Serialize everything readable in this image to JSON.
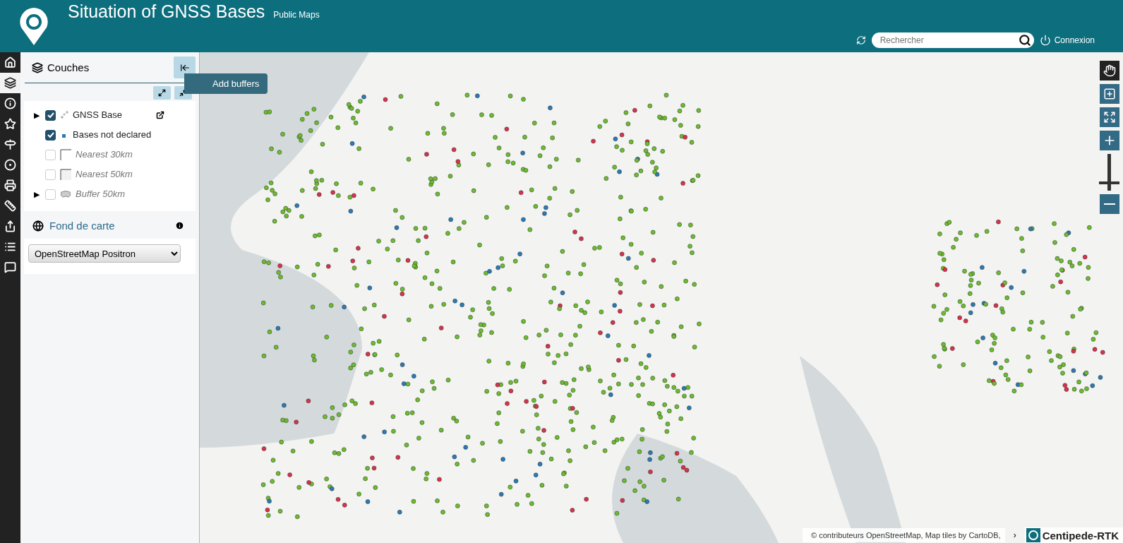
{
  "header": {
    "title": "Situation of GNSS Bases",
    "subtitle": "Public Maps",
    "search": {
      "placeholder": "Rechercher"
    },
    "login": "Connexion"
  },
  "sidebar": {
    "items": [
      {
        "selected": false
      },
      {
        "selected": true
      },
      {
        "selected": false
      },
      {
        "selected": false
      },
      {
        "selected": false
      },
      {
        "selected": false
      },
      {
        "selected": false
      },
      {
        "selected": false
      },
      {
        "selected": false
      },
      {
        "selected": false
      },
      {
        "selected": false
      }
    ]
  },
  "panel": {
    "title": "Couches",
    "tooltip": "Add buffers",
    "layers": [
      {
        "label": "GNSS Base",
        "kind": "points",
        "toggle": "▶",
        "checked": true,
        "disabled": false
      },
      {
        "label": "Bases not declared",
        "kind": "square",
        "checked": true,
        "disabled": false
      },
      {
        "label": "Nearest 30km",
        "kind": "line",
        "checked": false,
        "disabled": true
      },
      {
        "label": "Nearest 50km",
        "kind": "fill",
        "checked": false,
        "disabled": true
      },
      {
        "label": "Buffer 50km",
        "kind": "shape",
        "toggle": "▶",
        "checked": false,
        "disabled": true
      }
    ],
    "basemap": {
      "title": "Fond de carte",
      "value": "OpenStreetMap Positron"
    }
  },
  "map_tools": [
    {
      "selected": true
    },
    {
      "selected": false
    },
    {
      "selected": false
    }
  ],
  "zoom": {
    "level": 0.22
  },
  "attribution": {
    "text": "© contributeurs OpenStreetMap, Map tiles by CartoDB,",
    "toggle": "›",
    "logo": "Centipede-RTK"
  }
}
